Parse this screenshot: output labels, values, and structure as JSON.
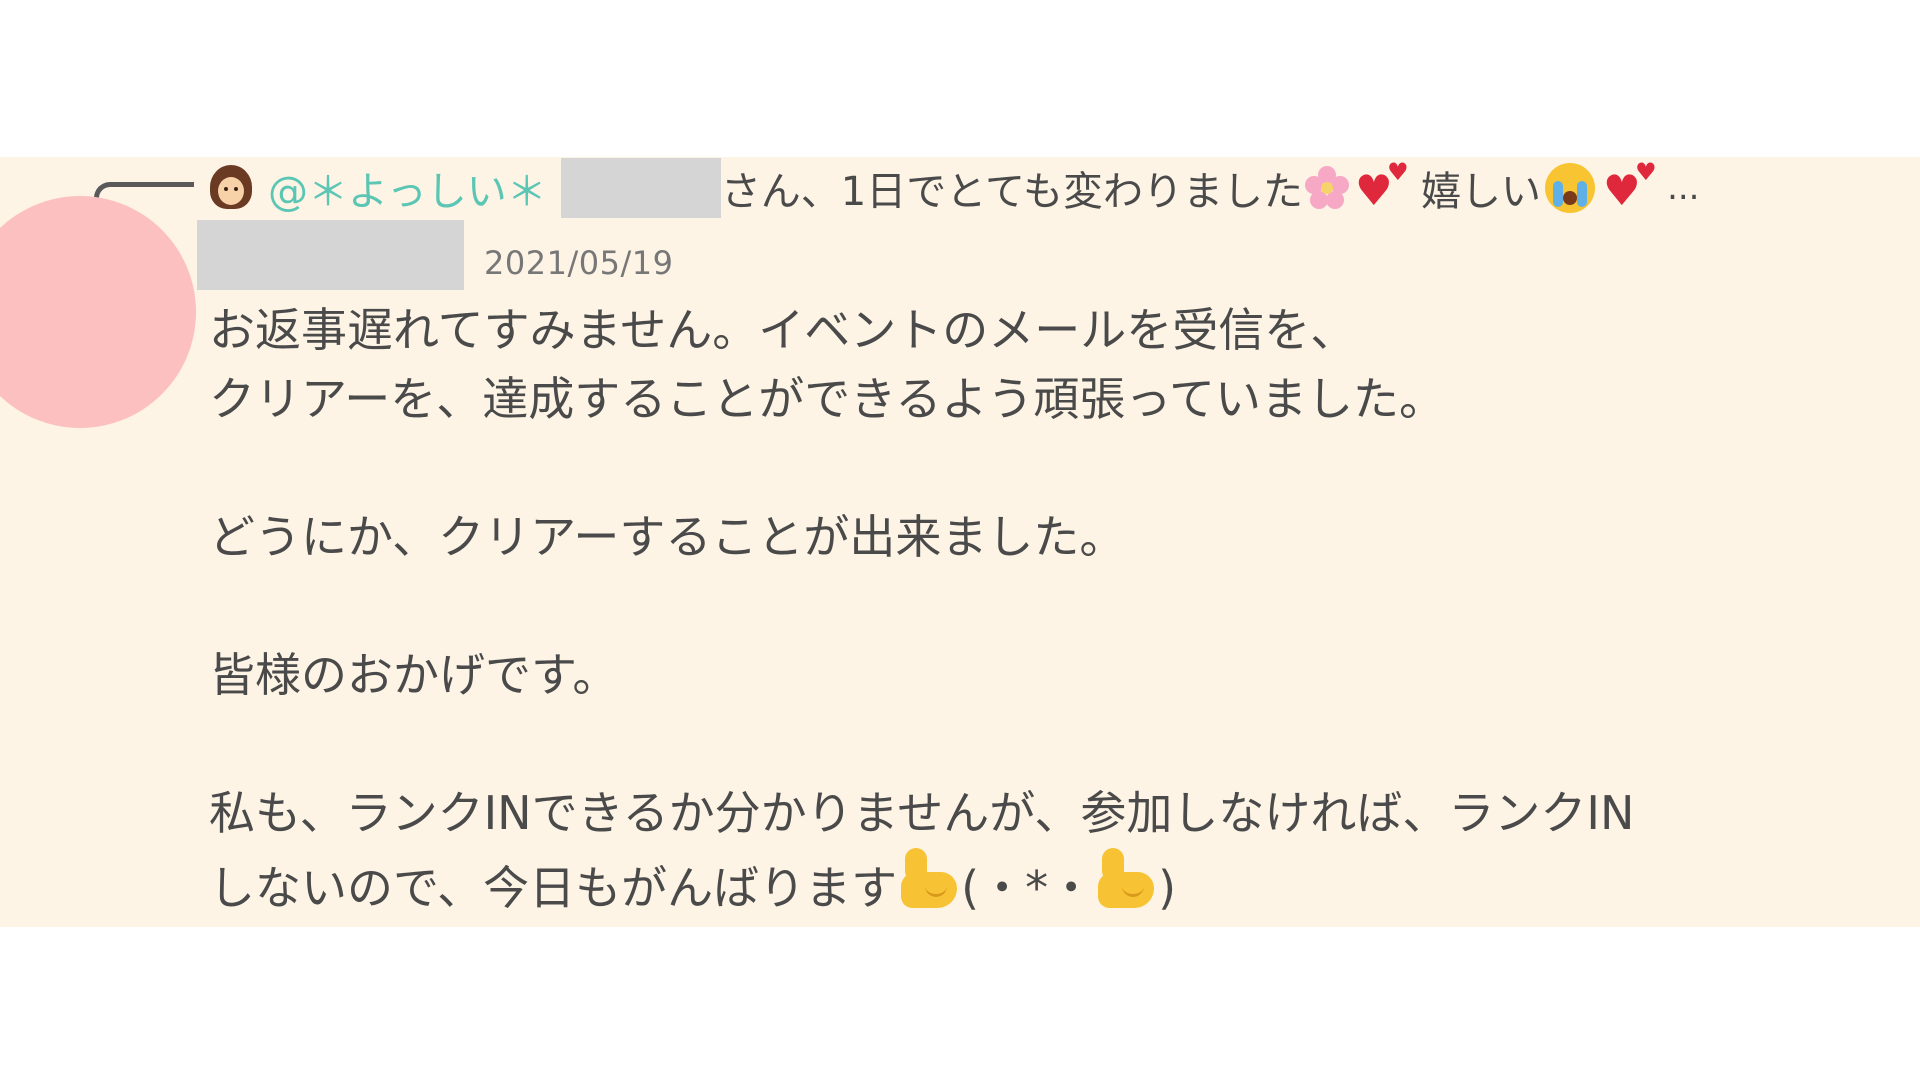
{
  "colors": {
    "post_background": "#fdf4e6",
    "avatar_placeholder": "#fdc0c0",
    "mention_color": "#5cc6b4",
    "text_color": "#4a4a4a",
    "date_color": "#777777",
    "redaction": "#d5d5d5"
  },
  "reply": {
    "mention": "@＊よっしい＊",
    "quoted_text": "さん、1日でとても変わりました",
    "quoted_text_2": "嬉しい",
    "ellipsis": "...",
    "icons": [
      "girl-avatar-icon",
      "cherry-blossom-icon",
      "two-hearts-icon",
      "crying-face-icon",
      "two-hearts-icon"
    ]
  },
  "post": {
    "date": "2021/05/19",
    "lines": {
      "l1": "お返事遅れてすみません。イベントのメールを受信を、",
      "l2": "クリアーを、達成することができるよう頑張っていました。",
      "l3": "どうにか、クリアーすることが出来ました。",
      "l4": "皆様のおかげです。",
      "l5": "私も、ランクINできるか分かりませんが、参加しなければ、ランクIN",
      "l6a": "しないので、今日もがんばります",
      "l6b": "(・*・",
      "l6c": ")"
    },
    "icons": [
      "flexed-biceps-icon",
      "flexed-biceps-icon"
    ]
  }
}
